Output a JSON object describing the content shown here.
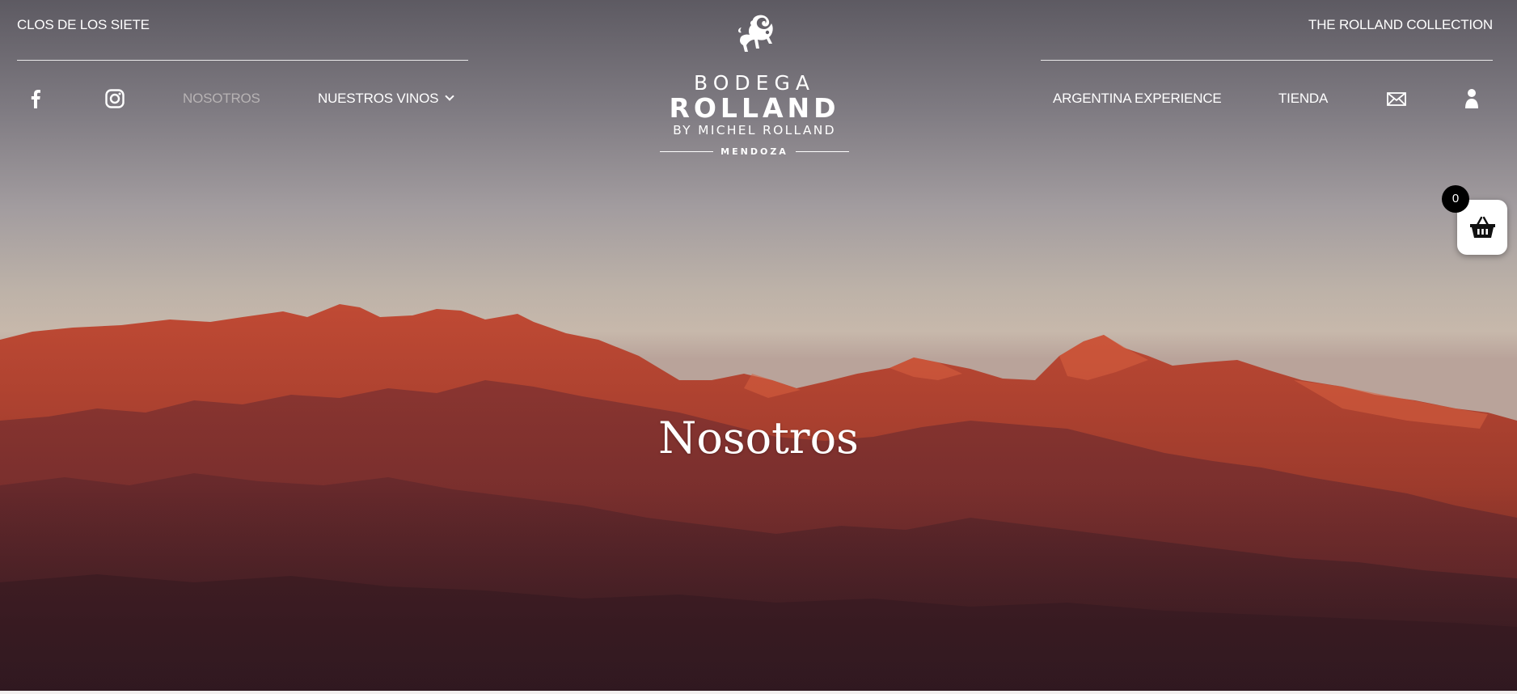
{
  "header": {
    "top_left_link": "CLOS DE LOS SIETE",
    "top_right_link": "THE ROLLAND COLLECTION",
    "nav_left": [
      {
        "label": "NOSOTROS",
        "active": true
      },
      {
        "label": "NUESTROS VINOS",
        "has_dropdown": true
      }
    ],
    "nav_right": [
      {
        "label": "ARGENTINA EXPERIENCE"
      },
      {
        "label": "TIENDA"
      }
    ],
    "social_icons": [
      "facebook-icon",
      "instagram-icon"
    ],
    "utility_icons": [
      "envelope-icon",
      "user-icon"
    ]
  },
  "logo": {
    "line1": "BODEGA",
    "line2": "ROLLAND",
    "line3": "BY MICHEL ROLLAND",
    "line4": "MENDOZA"
  },
  "hero": {
    "title": "Nosotros"
  },
  "cart": {
    "count": "0",
    "icon": "basket-icon"
  },
  "colors": {
    "text": "#ffffff",
    "active_nav": "#b7b3b4",
    "badge": "#000000"
  }
}
